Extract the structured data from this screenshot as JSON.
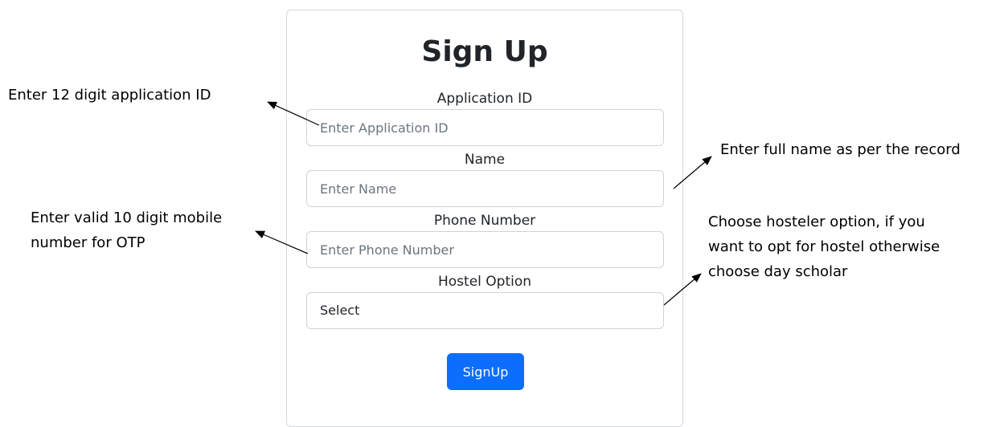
{
  "form": {
    "title": "Sign Up",
    "fields": [
      {
        "label": "Application ID",
        "placeholder": "Enter Application ID",
        "value": ""
      },
      {
        "label": "Name",
        "placeholder": "Enter Name",
        "value": ""
      },
      {
        "label": "Phone Number",
        "placeholder": "Enter Phone Number",
        "value": ""
      }
    ],
    "hostel": {
      "label": "Hostel Option",
      "selected": "Select"
    },
    "submit_label": "SignUp"
  },
  "annotations": {
    "application_id": "Enter 12 digit application ID",
    "name": "Enter full name as per the record",
    "phone_line1": "Enter valid 10 digit mobile",
    "phone_line2": "number for OTP",
    "hostel_line1": "Choose hosteler option, if you",
    "hostel_line2": "want to opt for hostel otherwise",
    "hostel_line3": "choose day scholar"
  },
  "colors": {
    "accent": "#0d6efd",
    "border": "#ced4da",
    "text": "#212529",
    "placeholder": "#6c757d"
  }
}
